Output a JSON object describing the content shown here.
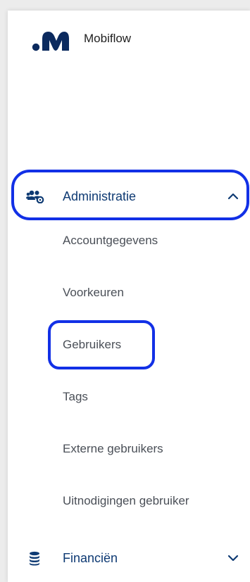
{
  "app": {
    "name": "Mobiflow",
    "logo": "mobiflow-logo"
  },
  "nav": {
    "administratie": {
      "label": "Administratie",
      "icon": "users-cog-icon",
      "expanded": true,
      "sub_items": [
        {
          "label": "Accountgegevens"
        },
        {
          "label": "Voorkeuren"
        },
        {
          "label": "Gebruikers"
        },
        {
          "label": "Tags"
        },
        {
          "label": "Externe gebruikers"
        },
        {
          "label": "Uitnodigingen gebruiker"
        }
      ]
    },
    "financien": {
      "label": "Financiën",
      "icon": "coins-icon",
      "expanded": false
    }
  },
  "colors": {
    "nav_text": "#0e3a73",
    "sub_text": "#4a4f57",
    "highlight": "#1230e6",
    "logo": "#0b2a5e"
  }
}
